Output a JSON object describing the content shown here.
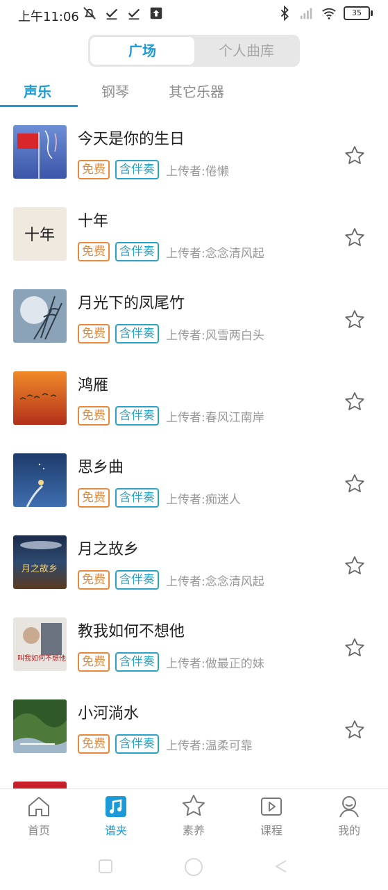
{
  "status": {
    "time": "上午11:06",
    "battery": "35"
  },
  "segmented": {
    "square": "广场",
    "library": "个人曲库"
  },
  "tabs": [
    "声乐",
    "钢琴",
    "其它乐器"
  ],
  "songs": [
    {
      "title": "今天是你的生日",
      "free": "免费",
      "acc": "含伴奏",
      "uploader": "上传者:倦懒"
    },
    {
      "title": "十年",
      "free": "免费",
      "acc": "含伴奏",
      "uploader": "上传者:念念清风起"
    },
    {
      "title": "月光下的凤尾竹",
      "free": "免费",
      "acc": "含伴奏",
      "uploader": "上传者:风雪两白头"
    },
    {
      "title": "鸿雁",
      "free": "免费",
      "acc": "含伴奏",
      "uploader": "上传者:春风江南岸"
    },
    {
      "title": "思乡曲",
      "free": "免费",
      "acc": "含伴奏",
      "uploader": "上传者:痴迷人"
    },
    {
      "title": "月之故乡",
      "free": "免费",
      "acc": "含伴奏",
      "uploader": "上传者:念念清风起"
    },
    {
      "title": "教我如何不想他",
      "free": "免费",
      "acc": "含伴奏",
      "uploader": "上传者:做最正的妹"
    },
    {
      "title": "小河淌水",
      "free": "免费",
      "acc": "含伴奏",
      "uploader": "上传者:温柔可靠"
    }
  ],
  "thumb_text": {
    "shinian": "十年",
    "yuezhi": "月之故乡",
    "jiaowo": "叫我如何不想他"
  },
  "nav": [
    "首页",
    "谱夹",
    "素养",
    "课程",
    "我的"
  ],
  "colors": {
    "accent": "#1a9bd7",
    "free": "#e8893a",
    "acc": "#2aa3c9"
  }
}
